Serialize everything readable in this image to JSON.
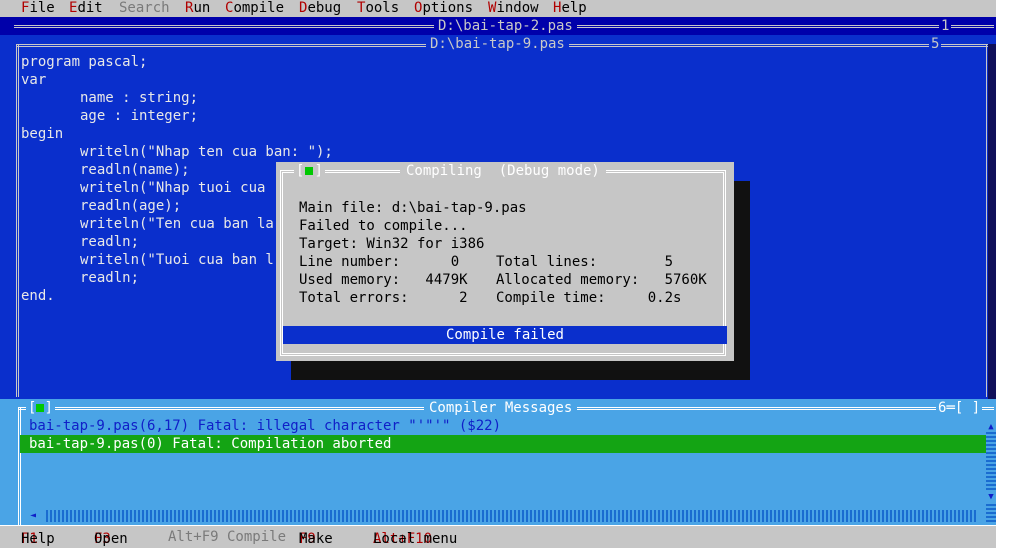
{
  "menu": {
    "items": [
      {
        "hot": "F",
        "rest": "ile"
      },
      {
        "hot": "E",
        "rest": "dit"
      },
      {
        "hot": "",
        "rest": "Search"
      },
      {
        "hot": "R",
        "rest": "un"
      },
      {
        "hot": "C",
        "rest": "ompile"
      },
      {
        "hot": "D",
        "rest": "ebug"
      },
      {
        "hot": "T",
        "rest": "ools"
      },
      {
        "hot": "O",
        "rest": "ptions"
      },
      {
        "hot": "W",
        "rest": "indow"
      },
      {
        "hot": "H",
        "rest": "elp"
      }
    ]
  },
  "windows": {
    "background": {
      "title": "D:\\bai-tap-2.pas",
      "number": "1"
    },
    "editor": {
      "title": "D:\\bai-tap-9.pas",
      "number": "5"
    }
  },
  "code": [
    "program pascal;",
    "var",
    "       name : string;",
    "       age : integer;",
    "begin",
    "       writeln(\"Nhap ten cua ban: \");",
    "       readln(name);",
    "       writeln(\"Nhap tuoi cua",
    "       readln(age);",
    "       writeln(\"Ten cua ban la",
    "       readln;",
    "       writeln(\"Tuoi cua ban l",
    "       readln;",
    "end."
  ],
  "dialog": {
    "title": "Compiling  (Debug mode)",
    "main_file": "Main file: d:\\bai-tap-9.pas",
    "status_line": "Failed to compile...",
    "target": "Target: Win32 for i386",
    "line_number": "Line number:      0",
    "total_lines": "Total lines:        5",
    "used_memory": "Used memory:   4479K",
    "allocated_memory": "Allocated memory:   5760K",
    "total_errors": "Total errors:      2",
    "compile_time": "Compile time:     0.2s",
    "result": "Compile failed"
  },
  "messages": {
    "title": "Compiler Messages",
    "number": "6",
    "items": [
      "bai-tap-9.pas(6,17) Fatal: illegal character \"'\"'\" ($22)",
      "bai-tap-9.pas(0) Fatal: Compilation aborted"
    ]
  },
  "statusline": {
    "f1_key": "F1",
    "f1_label": "Help",
    "f3_key": "F3",
    "f3_label": "Open",
    "altf9": "Alt+F9 Compile",
    "f9_key": "F9",
    "f9_label": "Make",
    "altf10_key": "Alt+F10",
    "altf10_label": "Local menu"
  },
  "colors": {
    "editor_bg": "#0a2fcc",
    "dialog_bg": "#c6c6c6",
    "messages_bg": "#4aa4e6",
    "selected_message_bg": "#14a414",
    "hotkey": "#b00000"
  }
}
